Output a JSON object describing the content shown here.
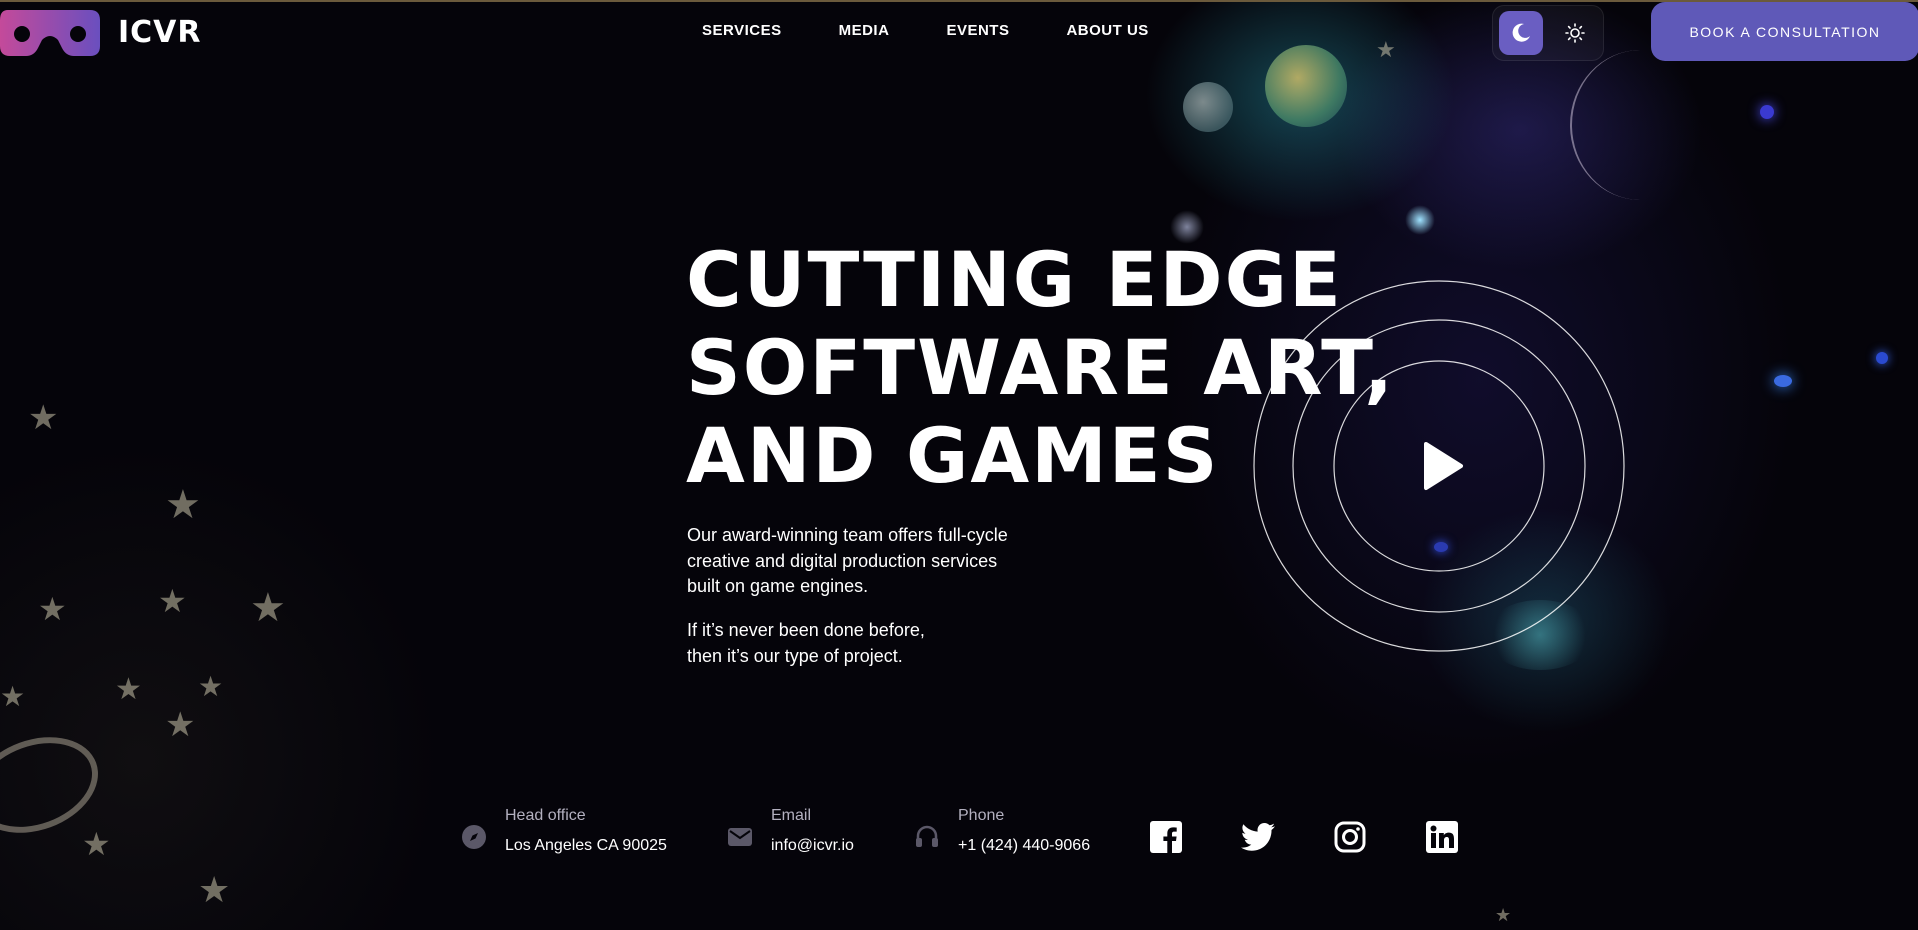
{
  "brand": {
    "name": "ICVR",
    "logo_colors": [
      "#c44a9a",
      "#6a4fbf"
    ]
  },
  "nav": {
    "items": [
      {
        "label": "SERVICES"
      },
      {
        "label": "MEDIA"
      },
      {
        "label": "EVENTS"
      },
      {
        "label": "ABOUT US"
      }
    ]
  },
  "theme": {
    "dark_icon": "moon-icon",
    "light_icon": "sun-icon",
    "active": "dark",
    "accent": "#6a5ec2"
  },
  "cta": {
    "label": "BOOK A CONSULTATION",
    "color": "#5f59b8"
  },
  "hero": {
    "title_lines": [
      "CUTTING EDGE",
      "SOFTWARE ART,",
      "AND GAMES"
    ],
    "description_lines": [
      "Our award-winning team offers full-cycle",
      "creative and digital production services",
      "built on game engines."
    ],
    "tagline_lines": [
      "If it’s never been done before,",
      "then it’s our type of project."
    ],
    "play_icon": "play-icon"
  },
  "contact": {
    "office": {
      "label": "Head office",
      "value": "Los Angeles CA 90025",
      "icon": "compass-icon"
    },
    "email": {
      "label": "Email",
      "value": "info@icvr.io",
      "icon": "envelope-icon"
    },
    "phone": {
      "label": "Phone",
      "value": "+1 (424) 440-9066",
      "icon": "headset-icon"
    }
  },
  "social": [
    {
      "name": "facebook",
      "icon": "facebook-icon"
    },
    {
      "name": "twitter",
      "icon": "twitter-icon"
    },
    {
      "name": "instagram",
      "icon": "instagram-icon"
    },
    {
      "name": "linkedin",
      "icon": "linkedin-icon"
    }
  ]
}
